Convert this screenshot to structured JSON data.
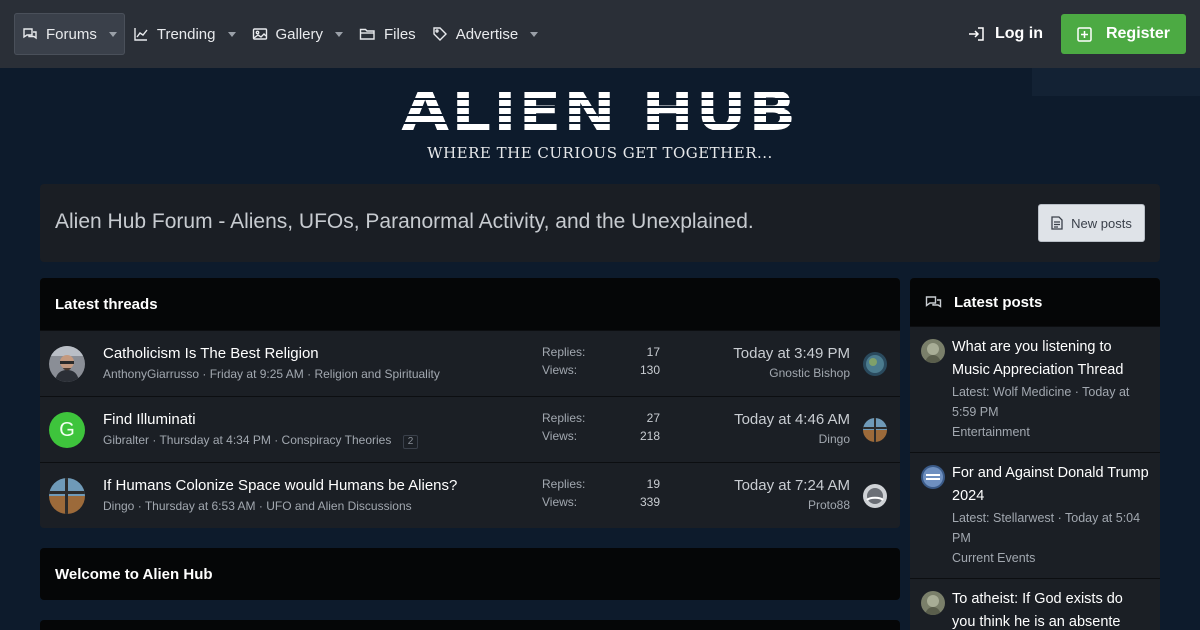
{
  "nav": {
    "items": [
      {
        "label": "Forums",
        "icon": "forums-icon",
        "dropdown": true,
        "active": true
      },
      {
        "label": "Trending",
        "icon": "trending-icon",
        "dropdown": true
      },
      {
        "label": "Gallery",
        "icon": "gallery-icon",
        "dropdown": true
      },
      {
        "label": "Files",
        "icon": "folder-icon",
        "dropdown": false
      },
      {
        "label": "Advertise",
        "icon": "tag-icon",
        "dropdown": true
      }
    ],
    "login_label": "Log in",
    "register_label": "Register"
  },
  "logo": {
    "title": "ALIEN HUB",
    "tagline": "WHERE THE CURIOUS GET TOGETHER..."
  },
  "intro": {
    "title": "Alien Hub Forum - Aliens, UFOs, Paranormal Activity, and the Unexplained.",
    "new_posts_label": "New posts"
  },
  "latest_threads": {
    "title": "Latest threads",
    "threads": [
      {
        "title": "Catholicism Is The Best Religion",
        "author": "AnthonyGiarrusso",
        "date": "Friday at 9:25 AM",
        "forum": "Religion and Spirituality",
        "pages": "",
        "replies_label": "Replies:",
        "replies": "17",
        "views_label": "Views:",
        "views": "130",
        "last_date": "Today at 3:49 PM",
        "last_user": "Gnostic Bishop"
      },
      {
        "title": "Find Illuminati",
        "author": "Gibralter",
        "date": "Thursday at 4:34 PM",
        "forum": "Conspiracy Theories",
        "pages": "2",
        "avatar_letter": "G",
        "replies_label": "Replies:",
        "replies": "27",
        "views_label": "Views:",
        "views": "218",
        "last_date": "Today at 4:46 AM",
        "last_user": "Dingo"
      },
      {
        "title": "If Humans Colonize Space would Humans be Aliens?",
        "author": "Dingo",
        "date": "Thursday at 6:53 AM",
        "forum": "UFO and Alien Discussions",
        "pages": "",
        "replies_label": "Replies:",
        "replies": "19",
        "views_label": "Views:",
        "views": "339",
        "last_date": "Today at 7:24 AM",
        "last_user": "Proto88"
      }
    ]
  },
  "welcome": {
    "title": "Welcome to Alien Hub"
  },
  "latest_posts": {
    "title": "Latest posts",
    "posts": [
      {
        "title": "What are you listening to Music Appreciation Thread",
        "latest": "Latest: Wolf Medicine · Today at 5:59 PM",
        "forum": "Entertainment"
      },
      {
        "title": "For and Against Donald Trump 2024",
        "latest": "Latest: Stellarwest · Today at 5:04 PM",
        "forum": "Current Events"
      },
      {
        "title": "To atheist: If God exists do you think he is an absente",
        "latest": "",
        "forum": ""
      }
    ]
  },
  "colors": {
    "background": "#0d1b2c",
    "nav": "#2a2f37",
    "register": "#4caa43",
    "block_header": "#050607",
    "block": "#1b1f25"
  }
}
